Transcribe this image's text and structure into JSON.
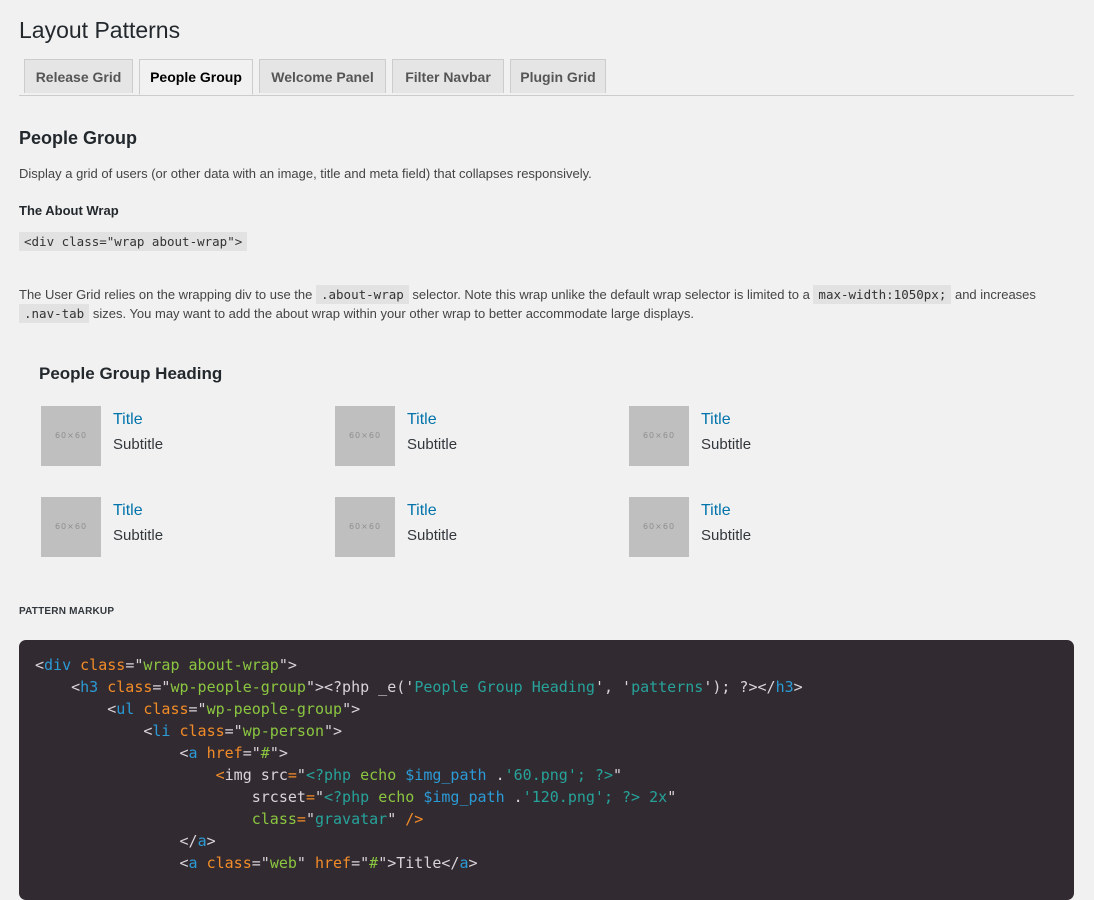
{
  "page_title": "Layout Patterns",
  "tabs": [
    {
      "label": "Release Grid",
      "active": false
    },
    {
      "label": "People Group",
      "active": true
    },
    {
      "label": "Welcome Panel",
      "active": false
    },
    {
      "label": "Filter Navbar",
      "active": false
    },
    {
      "label": "Plugin Grid",
      "active": false
    }
  ],
  "section": {
    "title": "People Group",
    "description": "Display a grid of users (or other data with an image, title and meta field) that collapses responsively.",
    "subheading": "The About Wrap",
    "wrap_code": "<div class=\"wrap about-wrap\">",
    "para": {
      "t1": "The User Grid relies on the wrapping div to use the ",
      "c1": ".about-wrap",
      "t2": " selector. Note this wrap unlike the default wrap selector is limited to a ",
      "c2": "max-width:1050px;",
      "t3": " and increases ",
      "c3": ".nav-tab",
      "t4": " sizes. You may want to add the about wrap within your other wrap to better accommodate large displays."
    }
  },
  "demo": {
    "heading": "People Group Heading",
    "people": [
      {
        "avatar": "60×60",
        "title": "Title",
        "subtitle": "Subtitle"
      },
      {
        "avatar": "60×60",
        "title": "Title",
        "subtitle": "Subtitle"
      },
      {
        "avatar": "60×60",
        "title": "Title",
        "subtitle": "Subtitle"
      },
      {
        "avatar": "60×60",
        "title": "Title",
        "subtitle": "Subtitle"
      },
      {
        "avatar": "60×60",
        "title": "Title",
        "subtitle": "Subtitle"
      },
      {
        "avatar": "60×60",
        "title": "Title",
        "subtitle": "Subtitle"
      }
    ]
  },
  "markup": {
    "label": "Pattern Markup",
    "lines": [
      [
        [
          "q",
          "<"
        ],
        [
          "t",
          "div"
        ],
        [
          "q",
          " "
        ],
        [
          "a",
          "class"
        ],
        [
          "q",
          "=\""
        ],
        [
          "s",
          "wrap about-wrap"
        ],
        [
          "q",
          "\">"
        ]
      ],
      [
        [
          "q",
          "    <"
        ],
        [
          "t",
          "h3"
        ],
        [
          "q",
          " "
        ],
        [
          "a",
          "class"
        ],
        [
          "q",
          "=\""
        ],
        [
          "s",
          "wp-people-group"
        ],
        [
          "q",
          "\"><?php _e('"
        ],
        [
          "p",
          "People Group Heading"
        ],
        [
          "q",
          "', '"
        ],
        [
          "p",
          "patterns"
        ],
        [
          "q",
          "'); ?></"
        ],
        [
          "t",
          "h3"
        ],
        [
          "q",
          ">"
        ]
      ],
      [
        [
          "q",
          "        <"
        ],
        [
          "t",
          "ul"
        ],
        [
          "q",
          " "
        ],
        [
          "a",
          "class"
        ],
        [
          "q",
          "=\""
        ],
        [
          "s",
          "wp-people-group"
        ],
        [
          "q",
          "\">"
        ]
      ],
      [
        [
          "q",
          "            <"
        ],
        [
          "t",
          "li"
        ],
        [
          "q",
          " "
        ],
        [
          "a",
          "class"
        ],
        [
          "q",
          "=\""
        ],
        [
          "s",
          "wp-person"
        ],
        [
          "q",
          "\">"
        ]
      ],
      [
        [
          "q",
          "                <"
        ],
        [
          "t",
          "a"
        ],
        [
          "q",
          " "
        ],
        [
          "a",
          "href"
        ],
        [
          "q",
          "=\""
        ],
        [
          "s",
          "#"
        ],
        [
          "q",
          "\">"
        ]
      ],
      [
        [
          "q",
          "                    "
        ],
        [
          "a",
          "<"
        ],
        [
          "q",
          "img src"
        ],
        [
          "a",
          "="
        ],
        [
          "q",
          "\""
        ],
        [
          "p",
          "<?php "
        ],
        [
          "e",
          "echo "
        ],
        [
          "v",
          "$img_path"
        ],
        [
          "q",
          " ."
        ],
        [
          "p",
          "'60.png'; ?>"
        ],
        [
          "q",
          "\""
        ]
      ],
      [
        [
          "q",
          "                        "
        ],
        [
          "q",
          "srcset"
        ],
        [
          "a",
          "="
        ],
        [
          "q",
          "\""
        ],
        [
          "p",
          "<?php "
        ],
        [
          "e",
          "echo "
        ],
        [
          "v",
          "$img_path"
        ],
        [
          "q",
          " ."
        ],
        [
          "p",
          "'120.png'; ?> 2x"
        ],
        [
          "q",
          "\""
        ]
      ],
      [
        [
          "q",
          "                        "
        ],
        [
          "e",
          "class"
        ],
        [
          "a",
          "="
        ],
        [
          "q",
          "\""
        ],
        [
          "p",
          "gravatar"
        ],
        [
          "q",
          "\" "
        ],
        [
          "a",
          "/>"
        ]
      ],
      [
        [
          "q",
          "                </"
        ],
        [
          "t",
          "a"
        ],
        [
          "q",
          ">"
        ]
      ],
      [
        [
          "q",
          "                <"
        ],
        [
          "t",
          "a"
        ],
        [
          "q",
          " "
        ],
        [
          "a",
          "class"
        ],
        [
          "q",
          "=\""
        ],
        [
          "s",
          "web"
        ],
        [
          "q",
          "\" "
        ],
        [
          "a",
          "href"
        ],
        [
          "q",
          "=\""
        ],
        [
          "s",
          "#"
        ],
        [
          "q",
          "\">Title</"
        ],
        [
          "t",
          "a"
        ],
        [
          "q",
          ">"
        ]
      ]
    ]
  }
}
